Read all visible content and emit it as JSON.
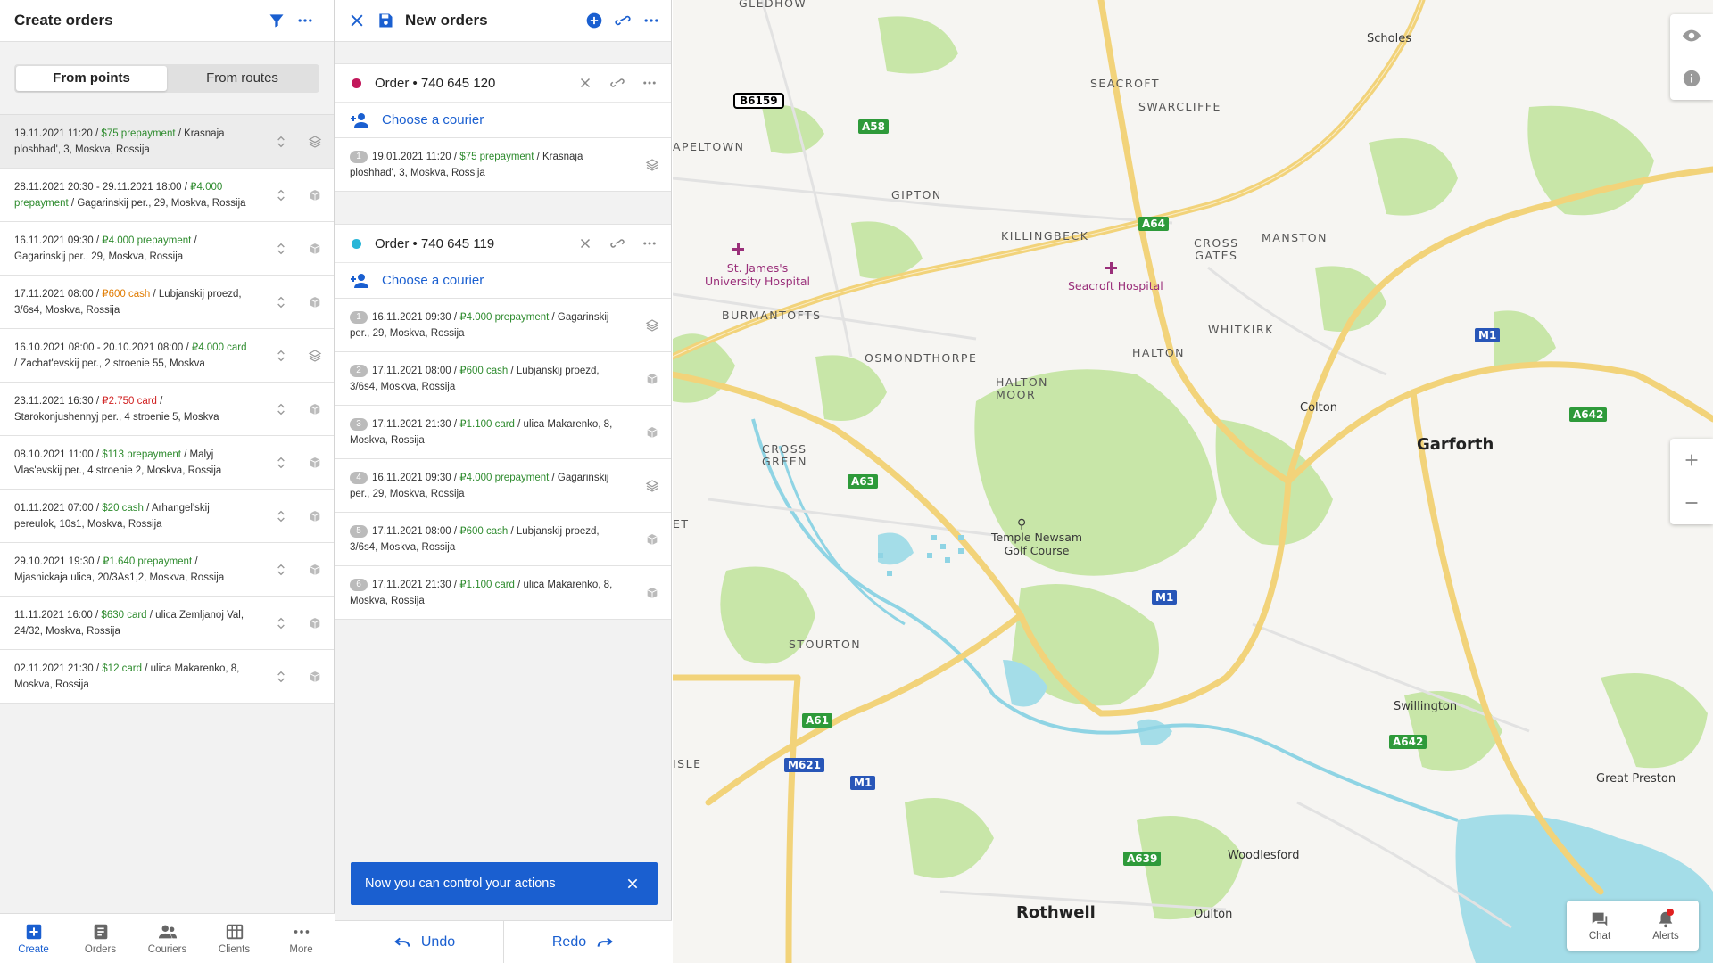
{
  "left": {
    "title": "Create orders",
    "seg_points": "From points",
    "seg_routes": "From routes",
    "points": [
      {
        "date": "19.11.2021 11:20",
        "pay": "$75 prepayment",
        "pay_color": "green",
        "addr": "Krasnaja ploshhad', 3, Moskva, Rossija",
        "icon": "layers-icon",
        "selected": true
      },
      {
        "date": "28.11.2021 20:30 - 29.11.2021 18:00",
        "pay": "₽4.000 prepayment",
        "pay_color": "green",
        "addr": "Gagarinskij per., 29, Moskva, Rossija",
        "icon": "box-icon"
      },
      {
        "date": "16.11.2021 09:30",
        "pay": "₽4.000 prepayment",
        "pay_color": "green",
        "addr": "Gagarinskij per., 29, Moskva, Rossija",
        "icon": "box-icon"
      },
      {
        "date": "17.11.2021 08:00",
        "pay": "₽600 cash",
        "pay_color": "orange",
        "addr": "Lubjanskij proezd, 3/6s4, Moskva, Rossija",
        "icon": "box-icon"
      },
      {
        "date": "16.10.2021 08:00 - 20.10.2021 08:00",
        "pay": "₽4.000 card",
        "pay_color": "green",
        "addr": "Zachat'evskij per., 2 stroenie 55, Moskva",
        "icon": "layers-icon"
      },
      {
        "date": "23.11.2021 16:30",
        "pay": "₽2.750 card",
        "pay_color": "red",
        "addr": "Starokonjushennyj per., 4 stroenie 5, Moskva",
        "icon": "box-icon"
      },
      {
        "date": "08.10.2021 11:00",
        "pay": "$113 prepayment",
        "pay_color": "green",
        "addr": "Malyj Vlas'evskij per., 4 stroenie 2, Moskva, Rossija",
        "icon": "box-icon"
      },
      {
        "date": "01.11.2021 07:00",
        "pay": "$20 cash",
        "pay_color": "green",
        "addr": "Arhangel'skij pereulok, 10s1, Moskva, Rossija",
        "icon": "box-icon"
      },
      {
        "date": "29.10.2021 19:30",
        "pay": "₽1.640 prepayment",
        "pay_color": "green",
        "addr": "Mjasnickaja ulica, 20/3As1,2, Moskva, Rossija",
        "icon": "box-icon"
      },
      {
        "date": "11.11.2021 16:00",
        "pay": "$630 card",
        "pay_color": "green",
        "addr": "ulica Zemljanoj Val, 24/32, Moskva, Rossija",
        "icon": "box-icon"
      },
      {
        "date": "02.11.2021 21:30",
        "pay": "$12 card",
        "pay_color": "green",
        "addr": "ulica Makarenko, 8, Moskva, Rossija",
        "icon": "box-icon"
      }
    ],
    "nav": [
      {
        "label": "Create",
        "icon": "create-icon",
        "active": true
      },
      {
        "label": "Orders",
        "icon": "orders-icon"
      },
      {
        "label": "Couriers",
        "icon": "couriers-icon"
      },
      {
        "label": "Clients",
        "icon": "clients-icon"
      },
      {
        "label": "More",
        "icon": "more-icon"
      }
    ]
  },
  "mid": {
    "title": "New orders",
    "groups": [
      {
        "name": "Order • 740 645 120",
        "dot_color": "#c2185b",
        "courier": "Choose a courier",
        "orders": [
          {
            "n": "1",
            "date": "19.01.2021 11:20",
            "pay": "$75 prepayment",
            "pay_color": "green",
            "addr": "Krasnaja ploshhad', 3, Moskva, Rossija",
            "icon": "layers-icon"
          }
        ]
      },
      {
        "name": "Order • 740 645 119",
        "dot_color": "#29b6d8",
        "courier": "Choose a courier",
        "orders": [
          {
            "n": "1",
            "date": "16.11.2021 09:30",
            "pay": "₽4.000 prepayment",
            "pay_color": "green",
            "addr": "Gagarinskij per., 29, Moskva, Rossija",
            "icon": "layers-icon"
          },
          {
            "n": "2",
            "date": "17.11.2021 08:00",
            "pay": "₽600 cash",
            "pay_color": "green",
            "addr": "Lubjanskij proezd, 3/6s4, Moskva, Rossija",
            "icon": "box-icon"
          },
          {
            "n": "3",
            "date": "17.11.2021 21:30",
            "pay": "₽1.100 card",
            "pay_color": "green",
            "addr": "ulica Makarenko, 8, Moskva, Rossija",
            "icon": "box-icon"
          },
          {
            "n": "4",
            "date": "16.11.2021 09:30",
            "pay": "₽4.000 prepayment",
            "pay_color": "green",
            "addr": "Gagarinskij per., 29, Moskva, Rossija",
            "icon": "layers-icon"
          },
          {
            "n": "5",
            "date": "17.11.2021 08:00",
            "pay": "₽600 cash",
            "pay_color": "green",
            "addr": "Lubjanskij proezd, 3/6s4, Moskva, Rossija",
            "icon": "box-icon"
          },
          {
            "n": "6",
            "date": "17.11.2021 21:30",
            "pay": "₽1.100 card",
            "pay_color": "green",
            "addr": "ulica Makarenko, 8, Moskva, Rossija",
            "icon": "box-icon"
          }
        ]
      }
    ],
    "toast": "Now you can control your actions",
    "undo": "Undo",
    "redo": "Redo"
  },
  "map": {
    "labels": {
      "gledhow": "GLEDHOW",
      "scholes": "Scholes",
      "seacroft": "SEACROFT",
      "swarcliffe": "SWARCLIFFE",
      "peltown": "APELTOWN",
      "gipton": "GIPTON",
      "killingbeck": "KILLINGBECK",
      "cross_gates": "CROSS\nGATES",
      "manston": "MANSTON",
      "st_james": "St. James's\nUniversity Hospital",
      "seacroft_hospital": "Seacroft Hospital",
      "burmantofts": "BURMANTOFTS",
      "whitkirk": "WHITKIRK",
      "osmondthorpe": "OSMONDTHORPE",
      "halton": "HALTON",
      "halton_moor": "HALTON\nMOOR",
      "colton": "Colton",
      "garforth": "Garforth",
      "cross_green": "CROSS\nGREEN",
      "temple_newsam": "Temple Newsam\nGolf Course",
      "et": "ET",
      "stourton": "STOURTON",
      "swillington": "Swillington",
      "isle": "ISLE",
      "great_preston": "Great Preston",
      "woodlesford": "Woodlesford",
      "rothwell": "Rothwell",
      "oulton": "Oulton"
    },
    "shields": {
      "b6159": "B6159",
      "a58": "A58",
      "a64": "A64",
      "m1_a": "M1",
      "a642_a": "A642",
      "a63": "A63",
      "m1_b": "M1",
      "a61": "A61",
      "m621": "M621",
      "m1_c": "M1",
      "a642_b": "A642",
      "a639": "A639"
    },
    "chat": "Chat",
    "alerts": "Alerts"
  }
}
